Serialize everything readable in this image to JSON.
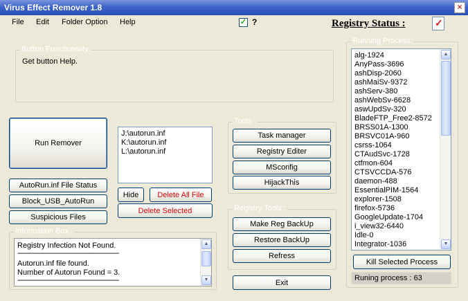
{
  "window": {
    "title": "Virus Effect Remover 1.8",
    "close_symbol": "×"
  },
  "menu": [
    "File",
    "Edit",
    "Folder Option",
    "Help"
  ],
  "topbar": {
    "checkbox_checked": true,
    "checkbox_mark": "✓",
    "help_mark": "?",
    "registry_status_label": "Registry Status :"
  },
  "button_functionality": {
    "legend": "Button Functionality:",
    "text": "Get button Help."
  },
  "main_buttons": {
    "run_remover": "Run Remover",
    "autorun_status": "AutoRun.inf File Status",
    "block_usb": "Block_USB_AutoRun",
    "suspicious": "Suspicious Files"
  },
  "autorun_list": [
    "J:\\autorun.inf",
    "K:\\autorun.inf",
    "L:\\autorun.inf"
  ],
  "file_buttons": {
    "hide": "Hide",
    "delete_all": "Delete All File",
    "delete_selected": "Delete Selected"
  },
  "tools": {
    "legend": "Tools :",
    "buttons": [
      "Task manager",
      "Registry Editer",
      "MSconfig",
      "HijackThis"
    ]
  },
  "registry_tools": {
    "legend": "Registry Tools :",
    "buttons": [
      "Make Reg  BackUp",
      "Restore BackUp",
      "Refress"
    ]
  },
  "info_box": {
    "legend": "Information Box :",
    "lines": [
      "Registry Infection Not Found.",
      "-------------------------------------------------------",
      "",
      "Autorun.inf file found.",
      "Number of Autorun Found  = 3.",
      "-------------------------------------------------------"
    ]
  },
  "exit_label": "Exit",
  "running": {
    "legend": "Running Process:",
    "processes": [
      "alg-1924",
      "AnyPass-3696",
      "ashDisp-2060",
      "ashMaiSv-9372",
      "ashServ-380",
      "ashWebSv-6628",
      "aswUpdSv-320",
      "BladeFTP_Free2-8572",
      "BRSS01A-1300",
      "BRSVC01A-960",
      "csrss-1064",
      "CTAudSvc-1728",
      "ctfmon-604",
      "CTSVCCDA-576",
      "daemon-488",
      "EssentialPIM-1564",
      "explorer-1508",
      "firefox-5736",
      "GoogleUpdate-1704",
      "i_view32-6440",
      "Idle-0",
      "Integrator-1036"
    ],
    "kill_label": "Kill Selected Process",
    "count_text": "Runing process : 63"
  },
  "colors": {
    "titlebar": "#2a50b8",
    "window_bg": "#ece9d8",
    "danger_text": "#e00000",
    "legend_text": "#ffffff"
  }
}
